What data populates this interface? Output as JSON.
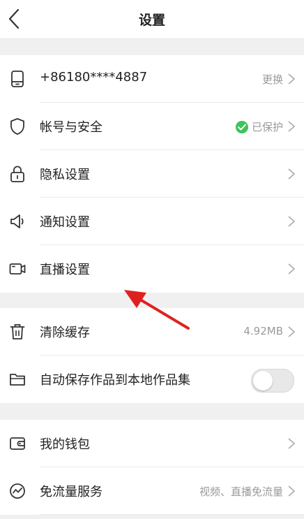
{
  "header": {
    "title": "设置",
    "back_icon": "chevron-left-icon"
  },
  "account_group": [
    {
      "icon": "phone-icon",
      "label": "+86180****4887",
      "value": "更换"
    },
    {
      "icon": "shield-icon",
      "label": "帐号与安全",
      "value": "已保护",
      "status_color": "#3fc35a"
    },
    {
      "icon": "lock-icon",
      "label": "隐私设置",
      "value": ""
    },
    {
      "icon": "megaphone-icon",
      "label": "通知设置",
      "value": ""
    },
    {
      "icon": "video-camera-icon",
      "label": "直播设置",
      "value": ""
    }
  ],
  "storage_group": [
    {
      "icon": "trash-icon",
      "label": "清除缓存",
      "value": "4.92MB"
    },
    {
      "icon": "folder-icon",
      "label": "自动保存作品到本地作品集",
      "toggle": false
    }
  ],
  "service_group": [
    {
      "icon": "wallet-icon",
      "label": "我的钱包",
      "value": ""
    },
    {
      "icon": "trend-circle-icon",
      "label": "免流量服务",
      "value": "视频、直播免流量"
    }
  ],
  "annotation": {
    "arrow_color": "#e02020"
  }
}
